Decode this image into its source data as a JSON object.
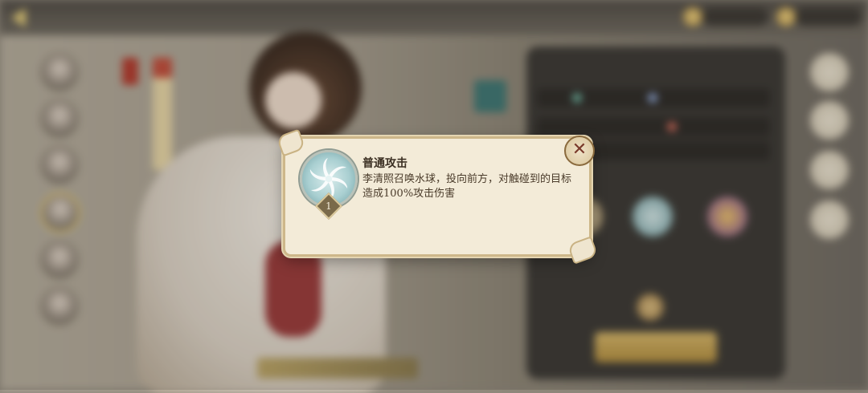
{
  "popup": {
    "skill_name": "普通攻击",
    "skill_description": "李清照召唤水球，投向前方，对触碰到的目标造成100%攻击伤害",
    "skill_level": "1",
    "skill_icon": "water-swirl-icon",
    "close_icon": "close-x-icon"
  },
  "colors": {
    "popup_bg": "#f3ebd8",
    "popup_border": "#cdb78a",
    "text": "#3b2f22",
    "skill_icon_teal": "#a9cfd1"
  }
}
